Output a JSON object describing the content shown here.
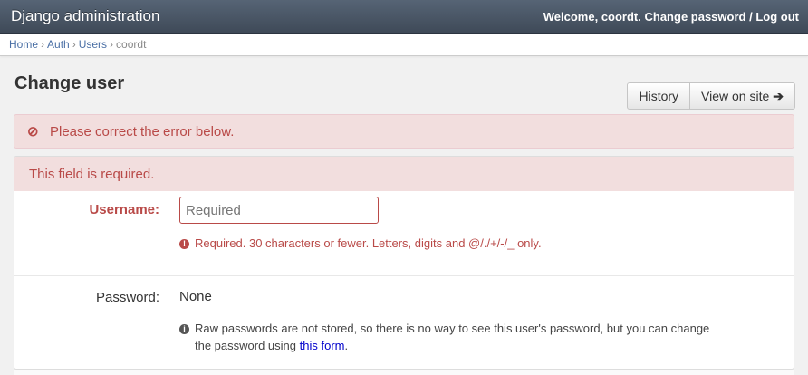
{
  "header": {
    "title": "Django administration",
    "welcome": "Welcome,",
    "username": "coordt",
    "change_password": "Change password",
    "separator": "/",
    "logout": "Log out"
  },
  "breadcrumbs": {
    "home": "Home",
    "auth": "Auth",
    "users": "Users",
    "current": "coordt",
    "sep": "›"
  },
  "page": {
    "title": "Change user"
  },
  "object_tools": {
    "history": "History",
    "view_on_site": "View on site",
    "arrow_icon": "arrow-right-icon"
  },
  "error_note": {
    "icon": "ban-circle-icon",
    "text": "Please correct the error below."
  },
  "form": {
    "field_error": "This field is required.",
    "username": {
      "label": "Username:",
      "value": "",
      "placeholder": "Required",
      "help_icon": "exclamation-circle-icon",
      "help": "Required. 30 characters or fewer. Letters, digits and @/./+/-/_ only."
    },
    "password": {
      "label": "Password:",
      "value": "None",
      "help_icon": "info-circle-icon",
      "help_line1": "Raw passwords are not stored, so there is no way to see this user's password, but you can change",
      "help_line2_prefix": "the password using",
      "help_link": "this form",
      "help_line2_suffix": "."
    }
  },
  "colors": {
    "header_bg": "#4b5767",
    "error_text": "#b94a48",
    "error_bg": "#f2dede",
    "link": "#4a6fa5"
  }
}
